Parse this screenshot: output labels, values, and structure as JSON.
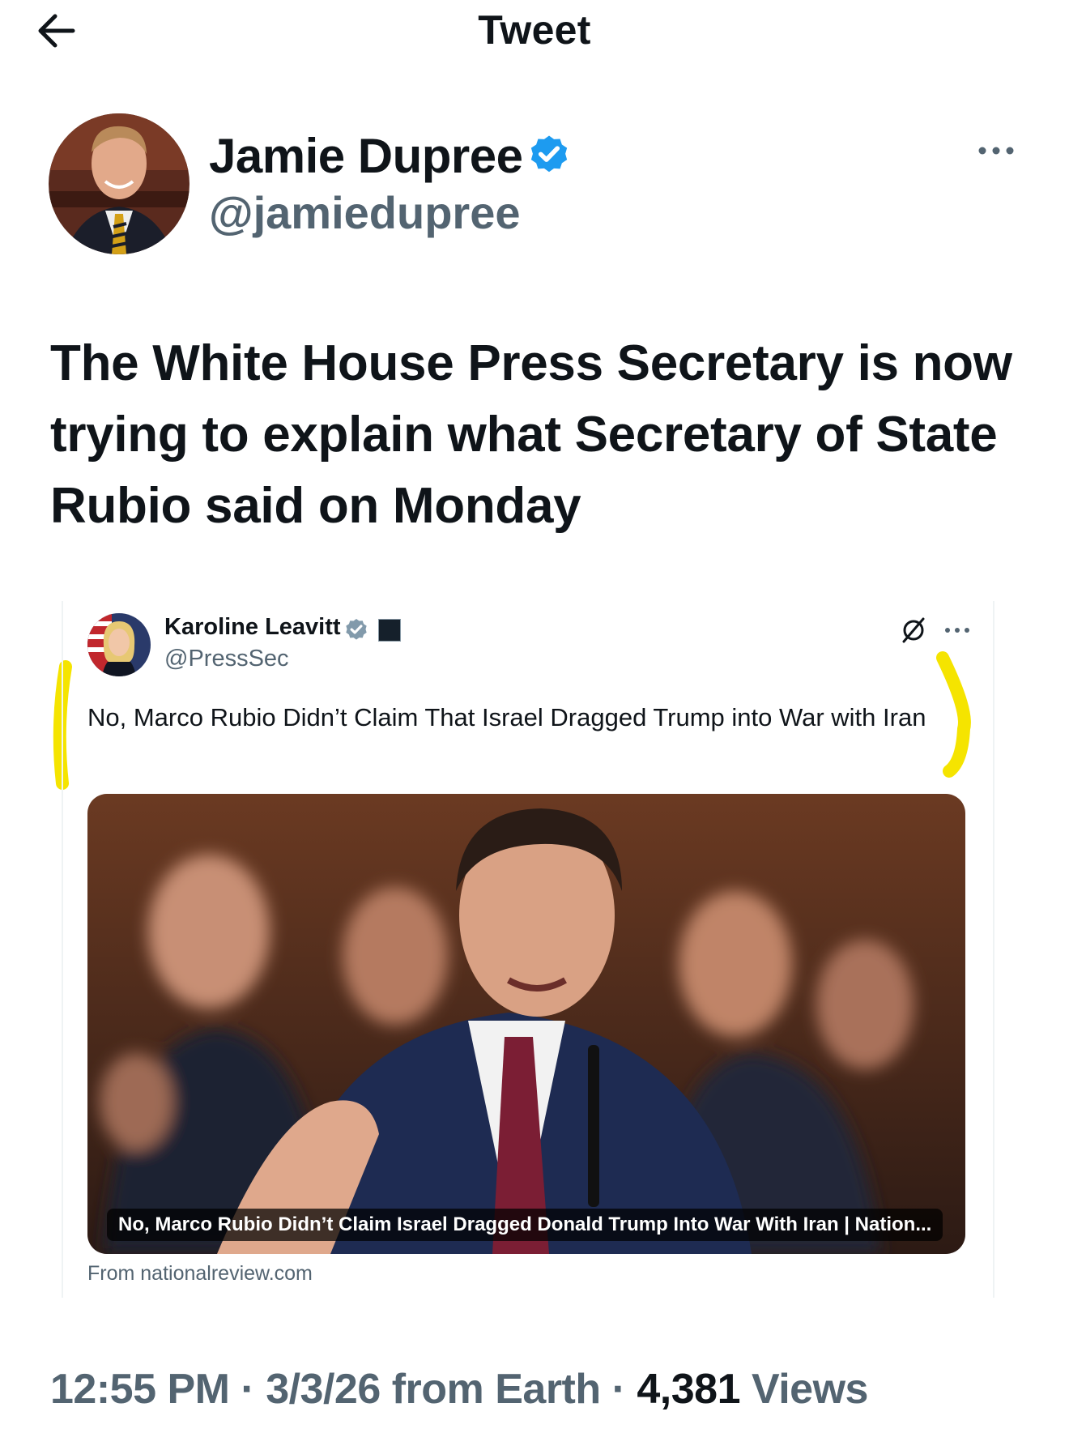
{
  "header": {
    "title": "Tweet",
    "back_icon": "arrow-left-icon"
  },
  "tweet": {
    "author": {
      "display_name": "Jamie Dupree",
      "handle": "@jamiedupree",
      "verified": true
    },
    "text": "The White House Press Secretary is now trying to explain what Secretary of State Rubio said on Monday",
    "time": "12:55 PM",
    "date": "3/3/26",
    "location": "from Earth",
    "separator": "·",
    "views_count": "4,381",
    "views_label": "Views"
  },
  "quoted": {
    "author": {
      "display_name": "Karoline Leavitt",
      "handle": "@PressSec",
      "verified": true
    },
    "text": "No, Marco Rubio Didn’t Claim That Israel Dragged Trump into War with Iran",
    "card": {
      "caption": "No, Marco Rubio Didn’t Claim Israel Dragged Donald Trump Into War With Iran | Nation...",
      "source": "From nationalreview.com"
    }
  },
  "colors": {
    "text_primary": "#0f1419",
    "text_secondary": "#536471",
    "verified_blue": "#1d9bf0",
    "verified_gray": "#829aab",
    "highlight_yellow": "#f5e400",
    "border": "#eff3f4"
  }
}
